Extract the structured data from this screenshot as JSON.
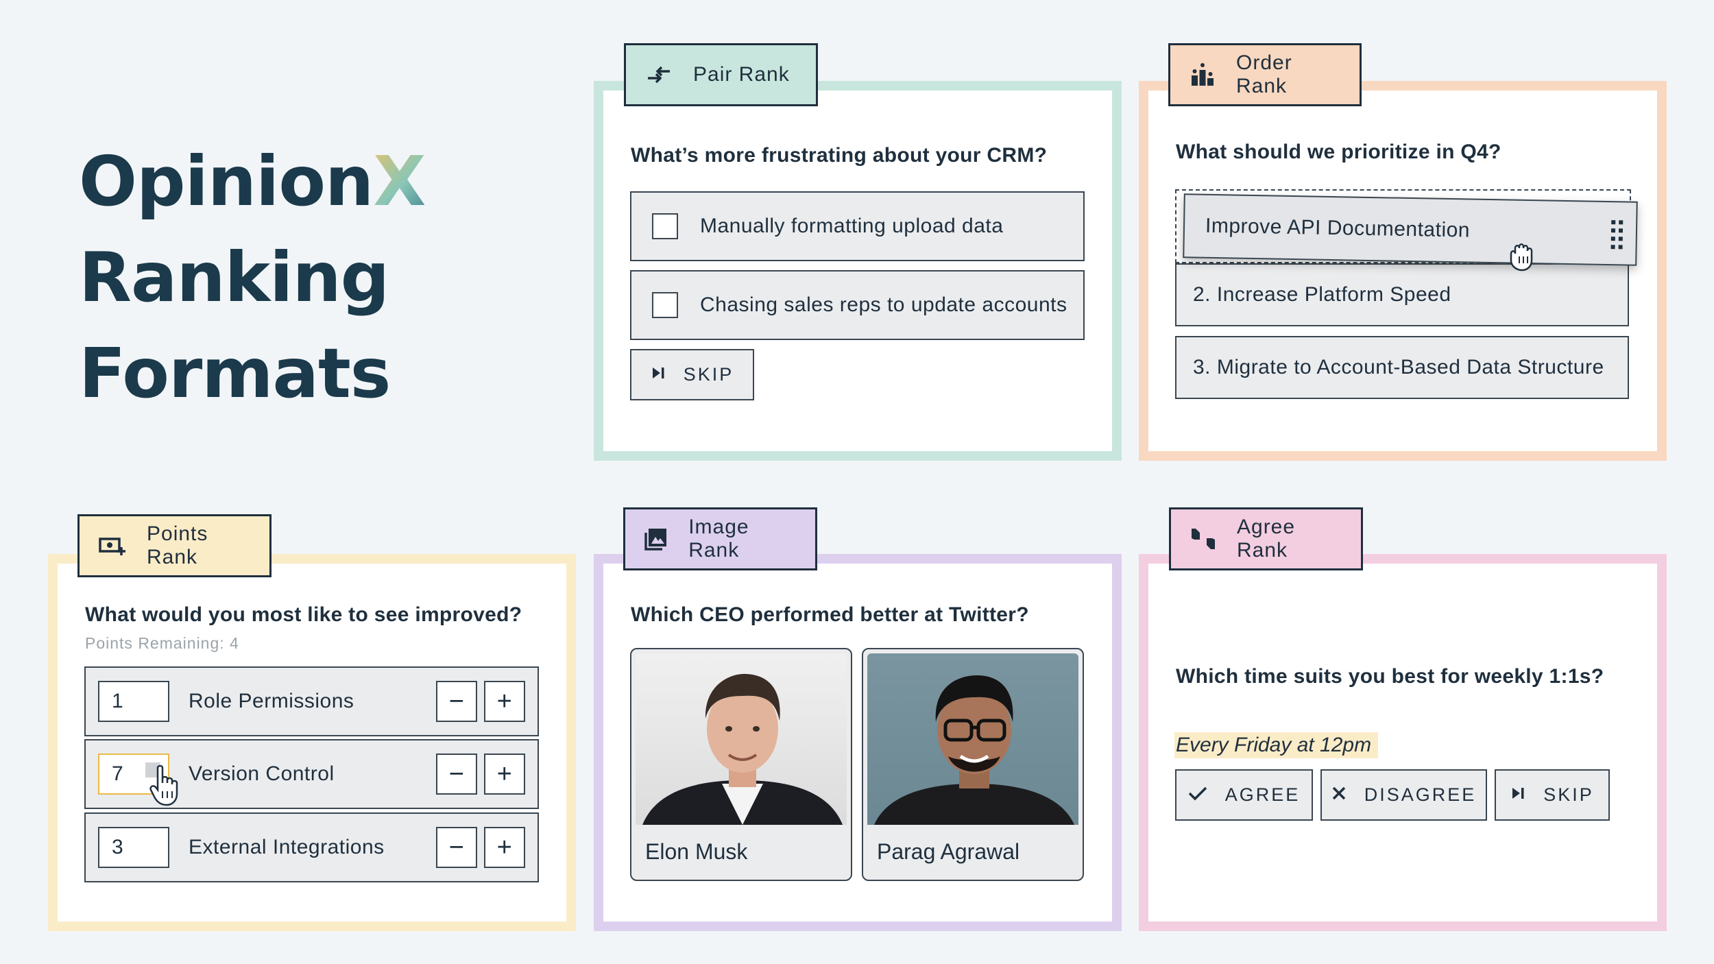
{
  "hero": {
    "line1": "Opinion",
    "x": "X",
    "line2": "Ranking",
    "line3": "Formats"
  },
  "pair": {
    "tab": "Pair Rank",
    "question": "What’s more frustrating about your CRM?",
    "options": [
      "Manually formatting upload data",
      "Chasing sales reps to update accounts"
    ],
    "skip": "SKIP",
    "color": "#c8e6dd"
  },
  "order": {
    "tab": "Order Rank",
    "question": "What should we prioritize in Q4?",
    "dragging": "Improve API Documentation",
    "items": [
      "2. Increase Platform Speed",
      "3. Migrate to Account-Based Data Structure"
    ],
    "color": "#f8d8c0"
  },
  "points": {
    "tab": "Points Rank",
    "question": "What would you most like to see improved?",
    "remaining": "Points Remaining: 4",
    "rows": [
      {
        "value": "1",
        "label": "Role Permissions"
      },
      {
        "value": "7",
        "label": "Version Control"
      },
      {
        "value": "3",
        "label": "External Integrations"
      }
    ],
    "minus": "−",
    "plus": "+",
    "color": "#fbecc8"
  },
  "image": {
    "tab": "Image Rank",
    "question": "Which CEO performed better at Twitter?",
    "people": [
      "Elon Musk",
      "Parag Agrawal"
    ],
    "color": "#ddd0ef"
  },
  "agree": {
    "tab": "Agree Rank",
    "question": "Which time suits you best for weekly 1:1s?",
    "statement": "Every Friday at 12pm",
    "buttons": {
      "agree": "AGREE",
      "disagree": "DISAGREE",
      "skip": "SKIP"
    },
    "color": "#f3cde0"
  }
}
